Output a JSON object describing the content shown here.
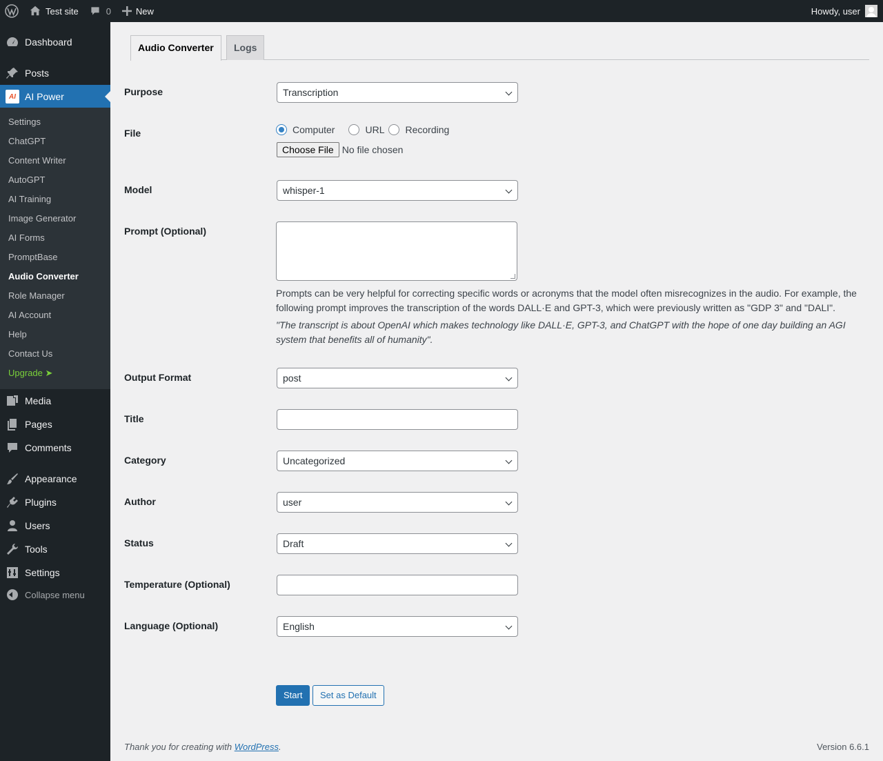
{
  "adminbar": {
    "site_name": "Test site",
    "comments_count": "0",
    "new_label": "New",
    "greeting": "Howdy, user"
  },
  "sidebar": {
    "top_items": [
      {
        "label": "Dashboard",
        "icon": "dashboard-icon"
      },
      {
        "label": "Posts",
        "icon": "pin-icon"
      },
      {
        "label": "AI Power",
        "icon": "ai-power-logo"
      }
    ],
    "submenu": [
      {
        "label": "Settings"
      },
      {
        "label": "ChatGPT"
      },
      {
        "label": "Content Writer"
      },
      {
        "label": "AutoGPT"
      },
      {
        "label": "AI Training"
      },
      {
        "label": "Image Generator"
      },
      {
        "label": "AI Forms"
      },
      {
        "label": "PromptBase"
      },
      {
        "label": "Audio Converter"
      },
      {
        "label": "Role Manager"
      },
      {
        "label": "AI Account"
      },
      {
        "label": "Help"
      },
      {
        "label": "Contact Us"
      },
      {
        "label": "Upgrade ➤"
      }
    ],
    "bottom_items": [
      {
        "label": "Media",
        "icon": "media-icon"
      },
      {
        "label": "Pages",
        "icon": "pages-icon"
      },
      {
        "label": "Comments",
        "icon": "comments-icon"
      },
      {
        "label": "Appearance",
        "icon": "brush-icon"
      },
      {
        "label": "Plugins",
        "icon": "plugin-icon"
      },
      {
        "label": "Users",
        "icon": "users-icon"
      },
      {
        "label": "Tools",
        "icon": "wrench-icon"
      },
      {
        "label": "Settings",
        "icon": "settings-icon"
      }
    ],
    "collapse_label": "Collapse menu"
  },
  "tabs": {
    "audio_converter": "Audio Converter",
    "logs": "Logs"
  },
  "form": {
    "purpose": {
      "label": "Purpose",
      "value": "Transcription"
    },
    "file": {
      "label": "File",
      "options": [
        "Computer",
        "URL",
        "Recording"
      ],
      "choose_label": "Choose File",
      "status": "No file chosen"
    },
    "model": {
      "label": "Model",
      "value": "whisper-1"
    },
    "prompt": {
      "label": "Prompt (Optional)",
      "help": "Prompts can be very helpful for correcting specific words or acronyms that the model often misrecognizes in the audio. For example, the following prompt improves the transcription of the words DALL·E and GPT-3, which were previously written as \"GDP 3\" and \"DALI\".",
      "example": "\"The transcript is about OpenAI which makes technology like DALL·E, GPT-3, and ChatGPT with the hope of one day building an AGI system that benefits all of humanity\"."
    },
    "output_format": {
      "label": "Output Format",
      "value": "post"
    },
    "title": {
      "label": "Title"
    },
    "category": {
      "label": "Category",
      "value": "Uncategorized"
    },
    "author": {
      "label": "Author",
      "value": "user"
    },
    "status": {
      "label": "Status",
      "value": "Draft"
    },
    "temperature": {
      "label": "Temperature (Optional)"
    },
    "language": {
      "label": "Language (Optional)",
      "value": "English"
    }
  },
  "buttons": {
    "start": "Start",
    "set_default": "Set as Default"
  },
  "footer": {
    "thanks_prefix": "Thank you for creating with ",
    "wordpress_link": "WordPress",
    "thanks_suffix": ".",
    "version": "Version 6.6.1"
  },
  "colors": {
    "accent": "#2271b1",
    "sidebar_bg": "#1d2327",
    "upgrade": "#7ad03a"
  }
}
